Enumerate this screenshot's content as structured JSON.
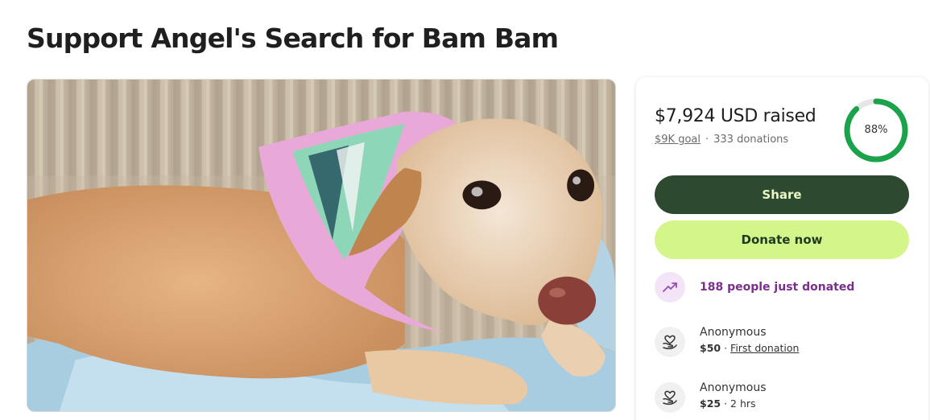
{
  "page": {
    "title": "Support Angel's Search for Bam Bam"
  },
  "photo": {
    "alt": "Photo of Bam Bam"
  },
  "progress": {
    "raised_text": "$7,924 USD raised",
    "goal_text": "$9K goal",
    "separator": "·",
    "donations_text": "333 donations",
    "percent_label": "88%",
    "percent": 88,
    "ring_color": "#1aa34a",
    "ring_track_color": "#e6e6e6"
  },
  "actions": {
    "share_label": "Share",
    "donate_label": "Donate now"
  },
  "activity": {
    "trend_text": "188 people just donated",
    "trend_icon": "trending-up-icon",
    "donors": [
      {
        "name": "Anonymous",
        "amount": "$50",
        "separator": "·",
        "tag": "First donation",
        "icon": "heart-hand-icon"
      },
      {
        "name": "Anonymous",
        "amount": "$25",
        "separator": "·",
        "tag": "2 hrs",
        "icon": "heart-hand-icon"
      }
    ]
  },
  "colors": {
    "share_bg": "#2d4a30",
    "donate_bg": "#d3f58a",
    "trend_text": "#7a2f8f"
  }
}
